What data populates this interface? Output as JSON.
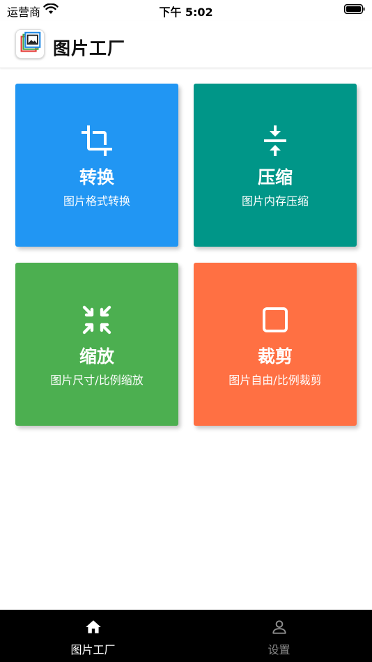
{
  "status_bar": {
    "carrier": "运营商",
    "time": "下午 5:02"
  },
  "app_bar": {
    "title": "图片工厂"
  },
  "tiles": [
    {
      "title": "转换",
      "subtitle": "图片格式转换",
      "icon": "crop-rotate-icon",
      "color": "#2196F3"
    },
    {
      "title": "压缩",
      "subtitle": "图片内存压缩",
      "icon": "vertical-align-center-icon",
      "color": "#009688"
    },
    {
      "title": "缩放",
      "subtitle": "图片尺寸/比例缩放",
      "icon": "fullscreen-exit-icon",
      "color": "#4CAF50"
    },
    {
      "title": "裁剪",
      "subtitle": "图片自由/比例裁剪",
      "icon": "crop-square-icon",
      "color": "#FF7043"
    }
  ],
  "tab_bar": {
    "items": [
      {
        "label": "图片工厂",
        "icon": "home-icon",
        "active": true
      },
      {
        "label": "设置",
        "icon": "person-icon",
        "active": false
      }
    ],
    "active_color": "#ffffff",
    "inactive_color": "#8e8e8e"
  }
}
